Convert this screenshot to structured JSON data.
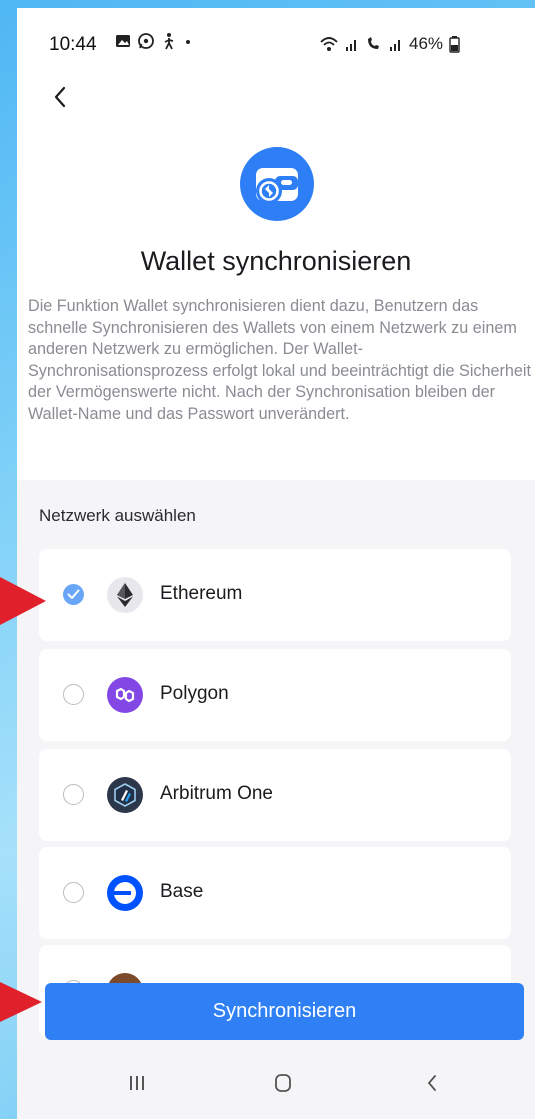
{
  "status_bar": {
    "time": "10:44",
    "battery": "46%"
  },
  "header": {
    "title": "Wallet synchronisieren",
    "description": "Die Funktion Wallet synchronisieren dient dazu, Benutzern das schnelle Synchronisieren des Wallets von einem Netzwerk zu einem anderen Netzwerk zu ermöglichen. Der Wallet-Synchronisationsprozess erfolgt lokal und beeinträchtigt die Sicherheit der Vermögenswerte nicht. Nach der Synchronisation bleiben der Wallet-Name und das Passwort unverändert."
  },
  "network_section": {
    "label": "Netzwerk auswählen",
    "networks": [
      {
        "name": "Ethereum",
        "selected": true,
        "icon": "ethereum-icon",
        "color": "#e8e8ec"
      },
      {
        "name": "Polygon",
        "selected": false,
        "icon": "polygon-icon",
        "color": "#8247e5"
      },
      {
        "name": "Arbitrum One",
        "selected": false,
        "icon": "arbitrum-icon",
        "color": "#2d374b"
      },
      {
        "name": "Base",
        "selected": false,
        "icon": "base-icon",
        "color": "#0052ff"
      },
      {
        "name": "",
        "selected": false,
        "icon": "network-icon",
        "color": "#7a4a2a"
      }
    ]
  },
  "actions": {
    "sync_button": "Synchronisieren"
  },
  "colors": {
    "accent": "#2f80f5",
    "annotation_arrow": "#e0202a"
  }
}
